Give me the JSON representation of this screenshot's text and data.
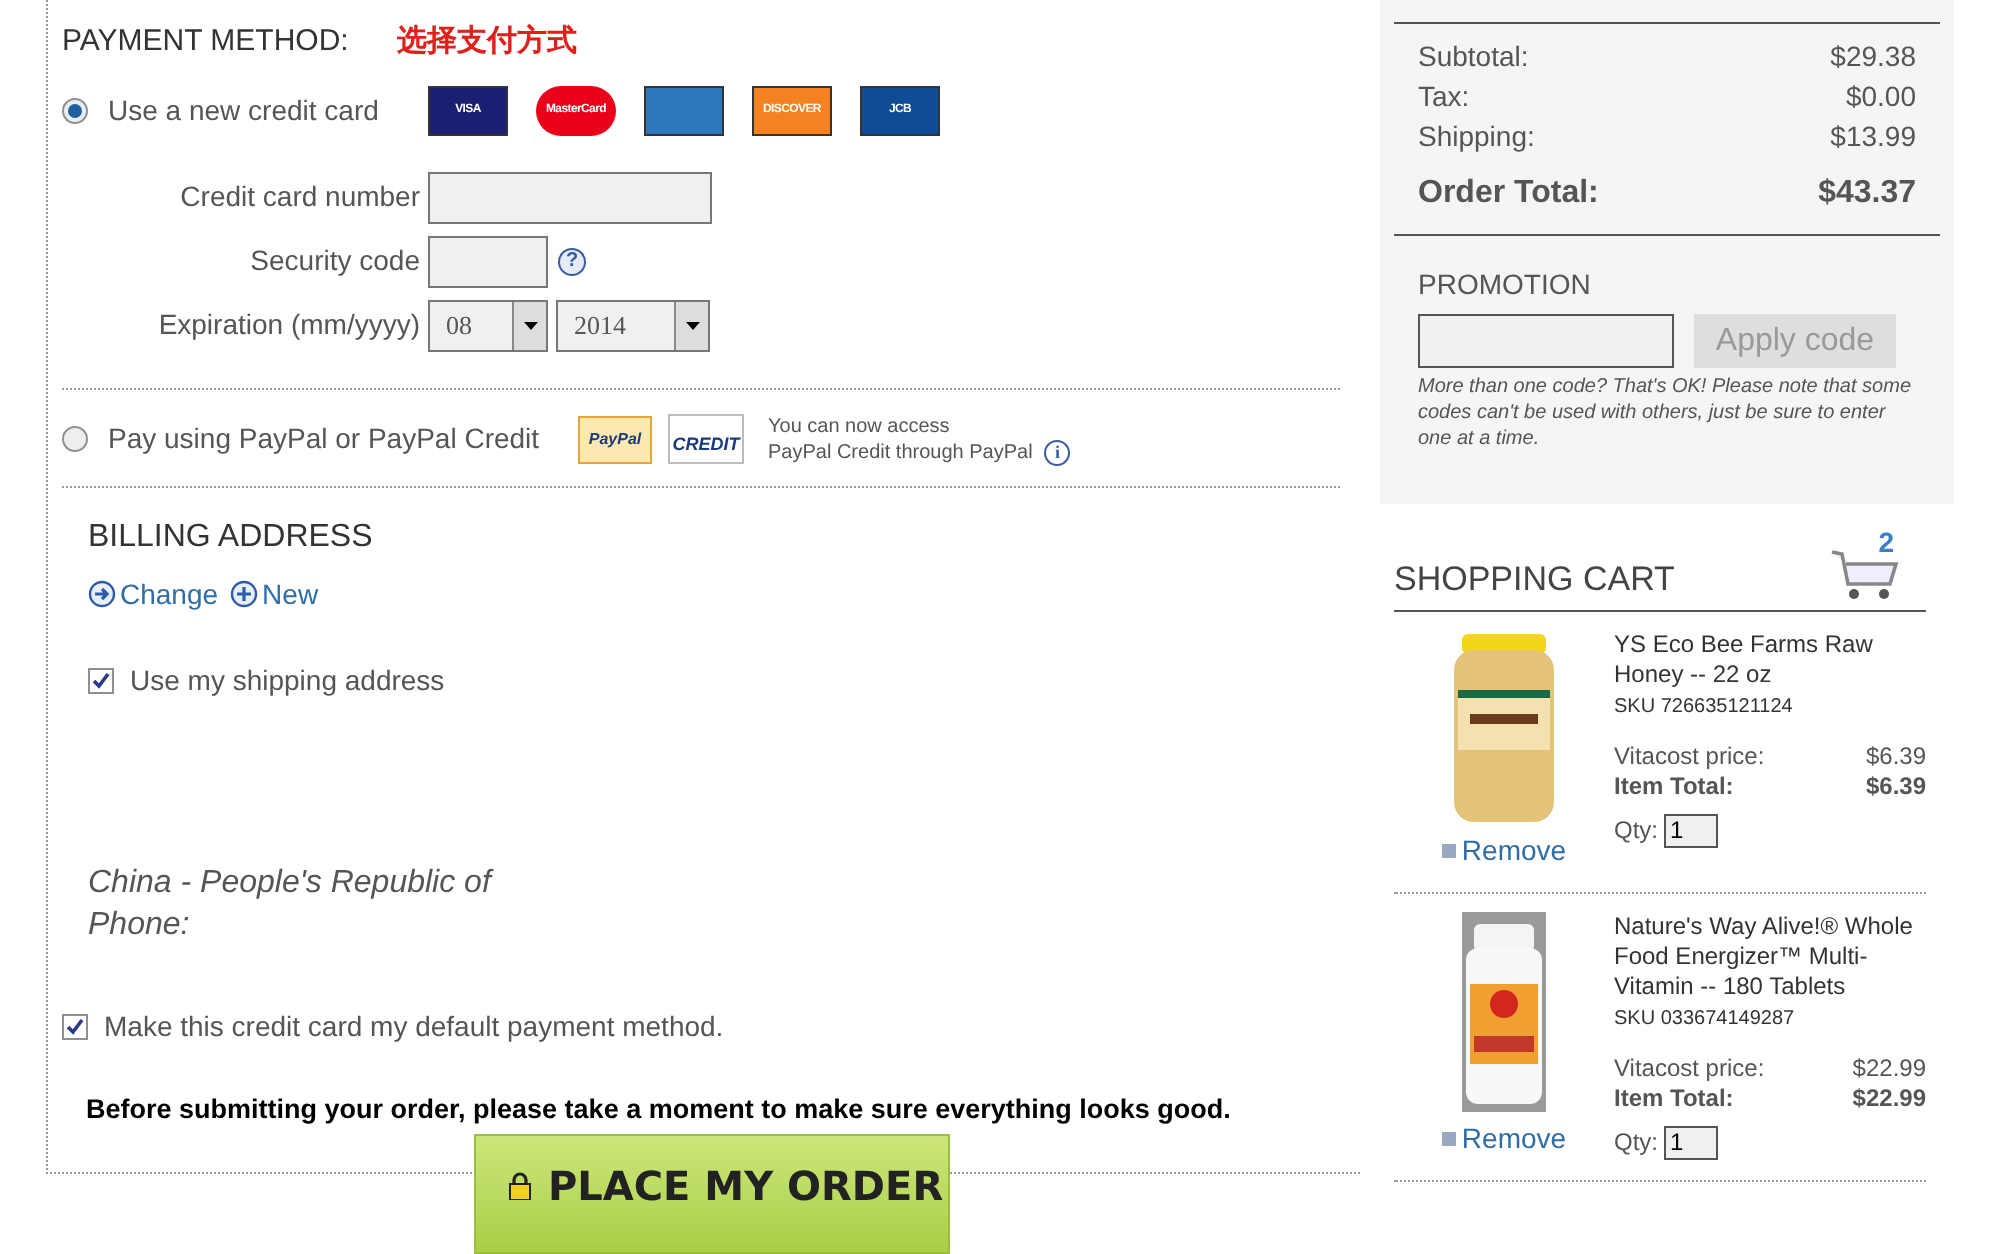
{
  "payment": {
    "title": "PAYMENT METHOD:",
    "note": "选择支付方式",
    "options": [
      {
        "kind": "card",
        "label": "Use a new credit card",
        "selected": true
      },
      {
        "kind": "paypal",
        "label": "Pay using PayPal or PayPal Credit",
        "selected": false
      }
    ],
    "card_logos": [
      {
        "label": "VISA",
        "color": "#1a1f71"
      },
      {
        "label": "MasterCard",
        "color": "#eb001b"
      },
      {
        "color": "#2e77bc"
      },
      {
        "label": "DISCOVER",
        "color": "#f58220"
      },
      {
        "label": "JCB",
        "color": "#0e4c96"
      }
    ],
    "fields": [
      {
        "kind": "text",
        "label": "Credit card number"
      },
      {
        "kind": "code",
        "label": "Security code"
      },
      {
        "kind": "expiry",
        "label": "Expiration (mm/yyyy)",
        "month": "08",
        "year": "2014"
      }
    ],
    "help_icon": "?",
    "info_icon": "i",
    "paypal_logos": [
      "PayPal",
      "CREDIT"
    ],
    "paypal_note": [
      "You can now access",
      "PayPal Credit through PayPal"
    ]
  },
  "billing": {
    "title": "BILLING ADDRESS",
    "links": [
      {
        "kind": "change",
        "label": "Change"
      },
      {
        "kind": "new",
        "label": "New"
      }
    ],
    "use_shipping": {
      "label": "Use my shipping address",
      "checked": true
    },
    "address": [
      "China - People's Republic of",
      "Phone:"
    ]
  },
  "default_card": {
    "label": "Make this credit card my default payment method.",
    "checked": true
  },
  "notice": "Before submitting your order, please take a moment to make sure everything looks good.",
  "place_order": "PLACE MY ORDER",
  "summary": {
    "rows": [
      {
        "label": "Subtotal:",
        "value": "$29.38"
      },
      {
        "label": "Tax:",
        "value": "$0.00"
      },
      {
        "label": "Shipping:",
        "value": "$13.99"
      }
    ],
    "total": {
      "label": "Order Total:",
      "value": "$43.37"
    }
  },
  "promotion": {
    "title": "PROMOTION",
    "button": "Apply code",
    "note": "More than one code? That's OK! Please note that some codes can't be used with others, just be sure to enter one at a time."
  },
  "cart": {
    "title": "SHOPPING CART",
    "count": "2",
    "items": [
      {
        "name": "YS Eco Bee Farms Raw Honey -- 22 oz",
        "sku": "SKU 726635121124",
        "price_label": "Vitacost price:",
        "price": "$6.39",
        "total_label": "Item Total:",
        "total": "$6.39",
        "qty_label": "Qty:",
        "qty": "1",
        "remove": "Remove",
        "color": "#e3c27a"
      },
      {
        "name": "Nature's Way Alive!® Whole Food Energizer™ Multi-Vitamin -- 180 Tablets",
        "sku": "SKU 033674149287",
        "price_label": "Vitacost price:",
        "price": "$22.99",
        "total_label": "Item Total:",
        "total": "$22.99",
        "qty_label": "Qty:",
        "qty": "1",
        "remove": "Remove",
        "color": "#f0a030"
      }
    ]
  }
}
